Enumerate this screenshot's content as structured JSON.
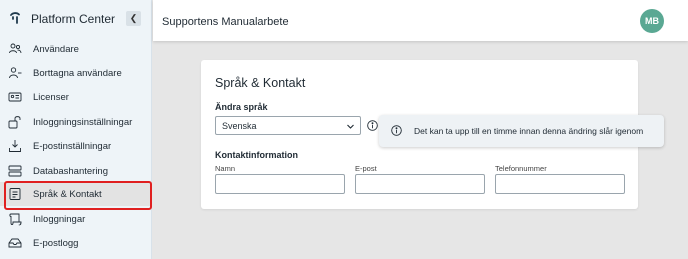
{
  "sidebar": {
    "brand": "Platform Center",
    "items": [
      {
        "label": "Användare",
        "icon": "users-icon"
      },
      {
        "label": "Borttagna användare",
        "icon": "user-minus-icon"
      },
      {
        "label": "Licenser",
        "icon": "id-card-icon"
      },
      {
        "label": "Inloggningsinställningar",
        "icon": "lock-open-icon"
      },
      {
        "label": "E-postinställningar",
        "icon": "download-tray-icon"
      },
      {
        "label": "Databashantering",
        "icon": "database-icon"
      },
      {
        "label": "Språk & Kontakt",
        "icon": "contact-card-icon",
        "active": true
      },
      {
        "label": "Inloggningar",
        "icon": "scroll-icon"
      },
      {
        "label": "E-postlogg",
        "icon": "mail-log-icon"
      }
    ]
  },
  "header": {
    "title": "Supportens Manualarbete",
    "avatar_initials": "MB",
    "avatar_color": "#5aa893"
  },
  "card": {
    "title": "Språk & Kontakt",
    "language": {
      "label": "Ändra språk",
      "selected": "Svenska"
    },
    "contact": {
      "label": "Kontaktinformation",
      "fields": [
        {
          "label": "Namn",
          "value": ""
        },
        {
          "label": "E-post",
          "value": ""
        },
        {
          "label": "Telefonnummer",
          "value": ""
        }
      ]
    }
  },
  "tooltip": {
    "text": "Det kan ta upp till en timme innan denna ändring slår igenom"
  },
  "colors": {
    "highlight": "#e02020",
    "sidebar_bg": "#eef4f8"
  }
}
